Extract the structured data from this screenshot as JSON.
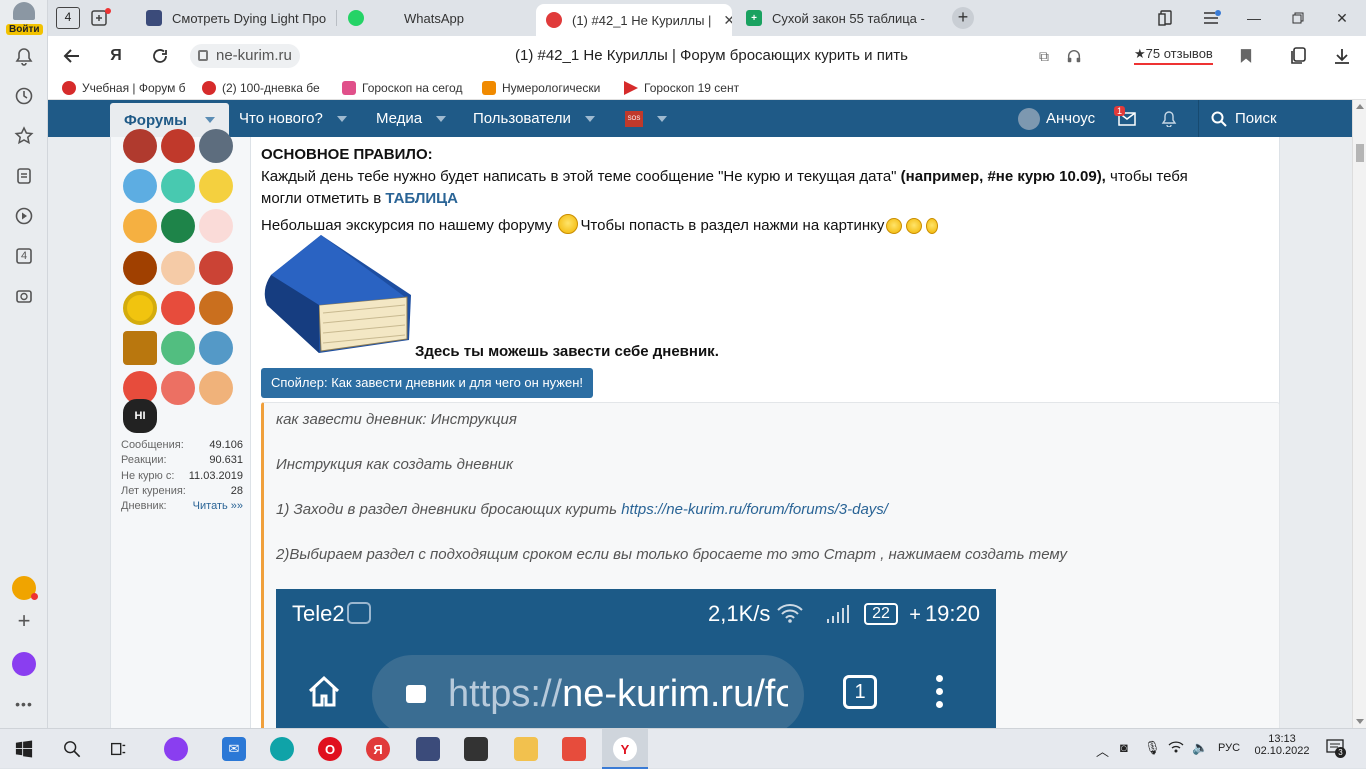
{
  "sidebar": {
    "login_label": "Войти",
    "tab_count": "4"
  },
  "tabs": {
    "counter": "4",
    "items": [
      {
        "label": "Смотреть Dying Light Про",
        "favicon_color": "#3b4b7a"
      },
      {
        "label": "WhatsApp",
        "favicon_color": "#25d366"
      },
      {
        "label": "(1) #42_1 Не Куриллы |",
        "favicon_color": "#e03b3b"
      },
      {
        "label": "Сухой закон 55 таблица -",
        "favicon_color": "#1aa260"
      }
    ],
    "new_tab_label": "+"
  },
  "address": {
    "url": "ne-kurim.ru",
    "page_title": "(1) #42_1 Не Куриллы | Форум бросающих курить и пить",
    "reviews": "★75 отзывов"
  },
  "bookmarks": [
    {
      "label": "Учебная | Форум б",
      "color": "#d62b2b"
    },
    {
      "label": "(2) 100-дневка бе",
      "color": "#d62b2b"
    },
    {
      "label": "Гороскоп на сегод",
      "color": "#e0508a"
    },
    {
      "label": "Нумерологически",
      "color": "#f08a00"
    },
    {
      "label": "Гороскоп 19 сент",
      "color": "#d62b2b"
    }
  ],
  "forum_nav": {
    "forums": "Форумы",
    "whats_new": "Что нового?",
    "media": "Медиа",
    "users": "Пользователи",
    "sos": "SOS",
    "username": "Анчоус",
    "messages_badge": "1",
    "search": "Поиск"
  },
  "user_stats": [
    {
      "label": "Сообщения:",
      "value": "49.106"
    },
    {
      "label": "Реакции:",
      "value": "90.631"
    },
    {
      "label": "Не курю с:",
      "value": "11.03.2019"
    },
    {
      "label": "Лет курения:",
      "value": "28"
    },
    {
      "label": "Дневник:",
      "value": "Читать »»"
    }
  ],
  "award_badge_text": "HI",
  "post": {
    "rule_heading": "ОСНОВНОЕ ПРАВИЛО:",
    "line1_a": "Каждый день тебе нужно будет написать в этой теме сообщение \"Не курю и текущая дата\" ",
    "line1_b": "(например, #не курю 10.09),",
    "line1_c": " чтобы тебя",
    "line2_a": "могли отметить в ",
    "line2_b": "ТАБЛИЦА",
    "line3_a": "Небольшая экскурсия по нашему форуму ",
    "line3_b": "Чтобы попасть в раздел нажми на картинку",
    "book_caption": "Здесь ты можешь завести себе дневник.",
    "spoiler_button": "Спойлер: Как завести дневник и для чего он нужен!",
    "spoiler": {
      "l1": "как завести дневник: Инструкция",
      "l2": "Инструкция как создать дневник",
      "l3_text": "1) Заходи в раздел дневники бросающих курить ",
      "l3_link": "https://ne-kurim.ru/forum/forums/3-days/",
      "l4": "2)Выбираем раздел с подходящим сроком если вы только бросаете то это Старт , нажимаем создать тему"
    },
    "phone": {
      "carrier": "Tele2",
      "speed": "2,1K/s",
      "battery": "22",
      "time": "19:20",
      "url_prefix": "https://",
      "url_host": "ne-kurim.ru/fo",
      "tab_count": "1"
    }
  },
  "taskbar": {
    "lang": "РУС",
    "time": "13:13",
    "date": "02.10.2022",
    "notif_count": "3"
  }
}
